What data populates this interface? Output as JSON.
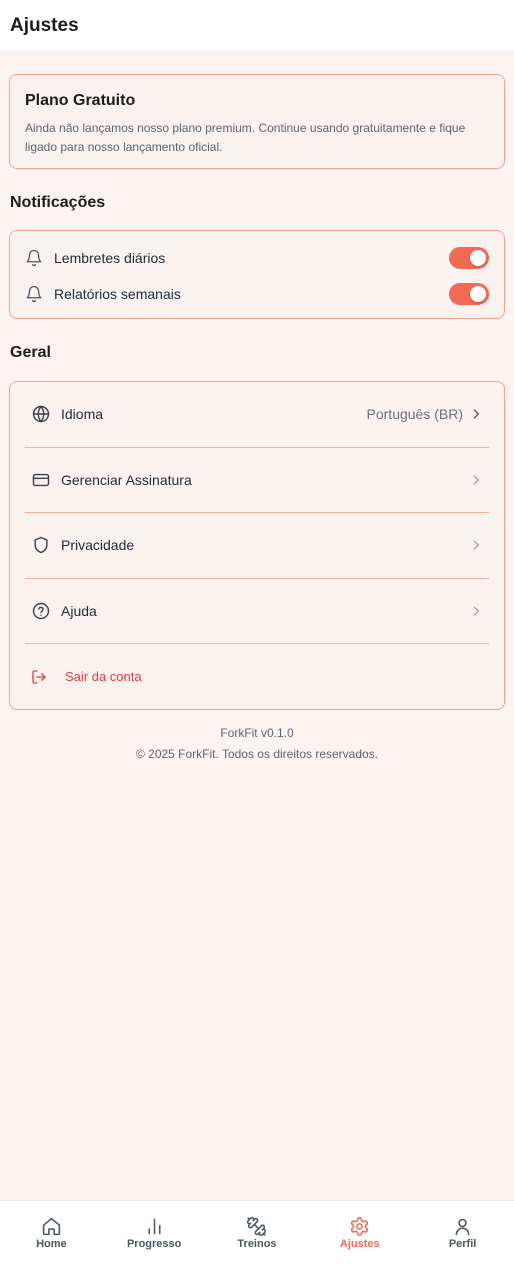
{
  "header": {
    "title": "Ajustes"
  },
  "plan": {
    "title": "Plano Gratuito",
    "description": "Ainda não lançamos nosso plano premium. Continue usando gratuitamente e fique ligado para nosso lançamento oficial."
  },
  "notifications": {
    "title": "Notificações",
    "items": [
      {
        "label": "Lembretes diários",
        "icon": "bell-icon",
        "enabled": true
      },
      {
        "label": "Relatórios semanais",
        "icon": "bell-icon",
        "enabled": true
      }
    ]
  },
  "general": {
    "title": "Geral",
    "items": [
      {
        "label": "Idioma",
        "icon": "globe-icon",
        "value": "Português (BR)"
      },
      {
        "label": "Gerenciar Assinatura",
        "icon": "credit-card-icon"
      },
      {
        "label": "Privacidade",
        "icon": "shield-icon"
      },
      {
        "label": "Ajuda",
        "icon": "help-circle-icon"
      }
    ],
    "logout": {
      "label": "Sair da conta",
      "icon": "logout-icon",
      "color": "#e03e3e"
    }
  },
  "footer": {
    "version": "ForkFit v0.1.0",
    "copyright": "© 2025 ForkFit. Todos os direitos reservados."
  },
  "tabbar": {
    "items": [
      {
        "label": "Home",
        "icon": "home-icon"
      },
      {
        "label": "Progresso",
        "icon": "bar-chart-icon"
      },
      {
        "label": "Treinos",
        "icon": "dumbbell-icon"
      },
      {
        "label": "Ajustes",
        "icon": "gear-icon",
        "active": true
      },
      {
        "label": "Perfil",
        "icon": "user-icon"
      }
    ]
  },
  "colors": {
    "accent": "#f26a54",
    "card_border": "#f2a38f",
    "background": "#fdf4f2",
    "danger": "#e03e3e"
  }
}
